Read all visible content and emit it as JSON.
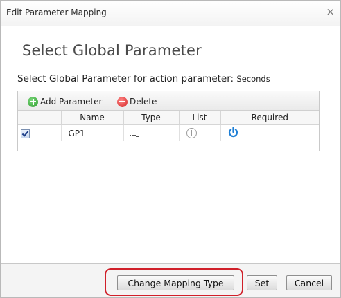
{
  "window": {
    "title": "Edit Parameter Mapping",
    "close_label": "×"
  },
  "main": {
    "heading": "Select Global Parameter",
    "subtitle_prefix": "Select Global Parameter for action parameter: ",
    "subtitle_param": "Seconds"
  },
  "toolbar": {
    "add_label": "Add Parameter",
    "delete_label": "Delete",
    "add_icon": "plus-circle-icon",
    "delete_icon": "minus-circle-icon"
  },
  "grid": {
    "columns": [
      "",
      "Name",
      "Type",
      "List",
      "Required"
    ],
    "rows": [
      {
        "checked": true,
        "name": "GP1",
        "type_icon": "list-type-icon",
        "list_icon": "info-circle-icon",
        "required_icon": "power-icon"
      }
    ]
  },
  "footer": {
    "change_mapping_label": "Change Mapping Type",
    "set_label": "Set",
    "cancel_label": "Cancel"
  },
  "colors": {
    "highlight": "#d0202a",
    "power_icon": "#1e7fd6",
    "add_icon": "#2a9a2a",
    "delete_icon": "#d42020"
  }
}
